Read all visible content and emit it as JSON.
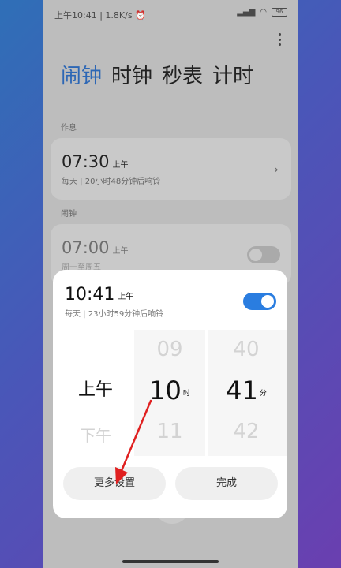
{
  "status": {
    "time": "上午10:41",
    "speed": "1.8K/s",
    "signal": "⁴ᴳ",
    "battery": "96"
  },
  "tabs": [
    "闹钟",
    "时钟",
    "秒表",
    "计时"
  ],
  "sections": {
    "nap": "作息",
    "alarm": "闹钟"
  },
  "nap_card": {
    "time": "07:30",
    "ampm": "上午",
    "sub": "每天 | 20小时48分钟后响铃"
  },
  "alarm_card": {
    "time": "07:00",
    "ampm": "上午",
    "sub": "周一至周五"
  },
  "dialog": {
    "time": "10:41",
    "ampm": "上午",
    "sub": "每天 | 23小时59分钟后响铃",
    "picker": {
      "ampm": {
        "selected": "上午",
        "below": "下午"
      },
      "hour": {
        "above": "09",
        "selected": "10",
        "below": "11",
        "unit": "时"
      },
      "minute": {
        "above": "40",
        "selected": "41",
        "below": "42",
        "unit": "分"
      }
    },
    "more_label": "更多设置",
    "done_label": "完成"
  },
  "colors": {
    "accent": "#2a7de0",
    "tab_active": "#2d67b5",
    "arrow": "#e02020"
  }
}
